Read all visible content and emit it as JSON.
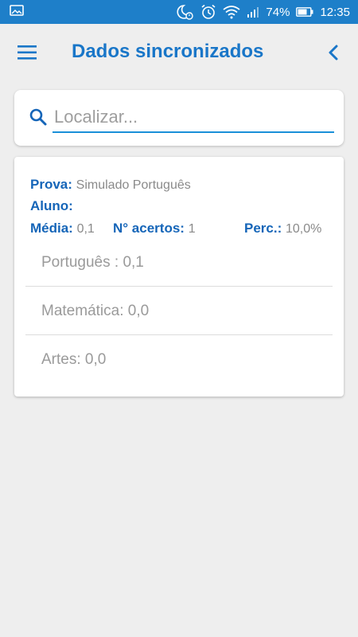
{
  "status_bar": {
    "battery": "74%",
    "time": "12:35",
    "icons": [
      "image-icon",
      "moon-clock-icon",
      "alarm-icon",
      "wifi-icon",
      "signal-icon",
      "battery-icon"
    ],
    "bg_color": "#1e7fc9"
  },
  "header": {
    "title": "Dados sincronizados",
    "menu_icon": "hamburger-menu-icon",
    "back_icon": "chevron-left-icon",
    "accent_color": "#1976c8"
  },
  "search": {
    "placeholder": "Localizar...",
    "value": ""
  },
  "result": {
    "prova_label": "Prova:",
    "prova_value": "Simulado Português",
    "aluno_label": "Aluno:",
    "aluno_value": "",
    "media_label": "Média:",
    "media_value": "0,1",
    "acertos_label": "N° acertos:",
    "acertos_value": "1",
    "perc_label": "Perc.:",
    "perc_value": "10,0%",
    "subjects": [
      {
        "text": "Português : 0,1"
      },
      {
        "text": "Matemática: 0,0"
      },
      {
        "text": "Artes: 0,0"
      }
    ]
  }
}
